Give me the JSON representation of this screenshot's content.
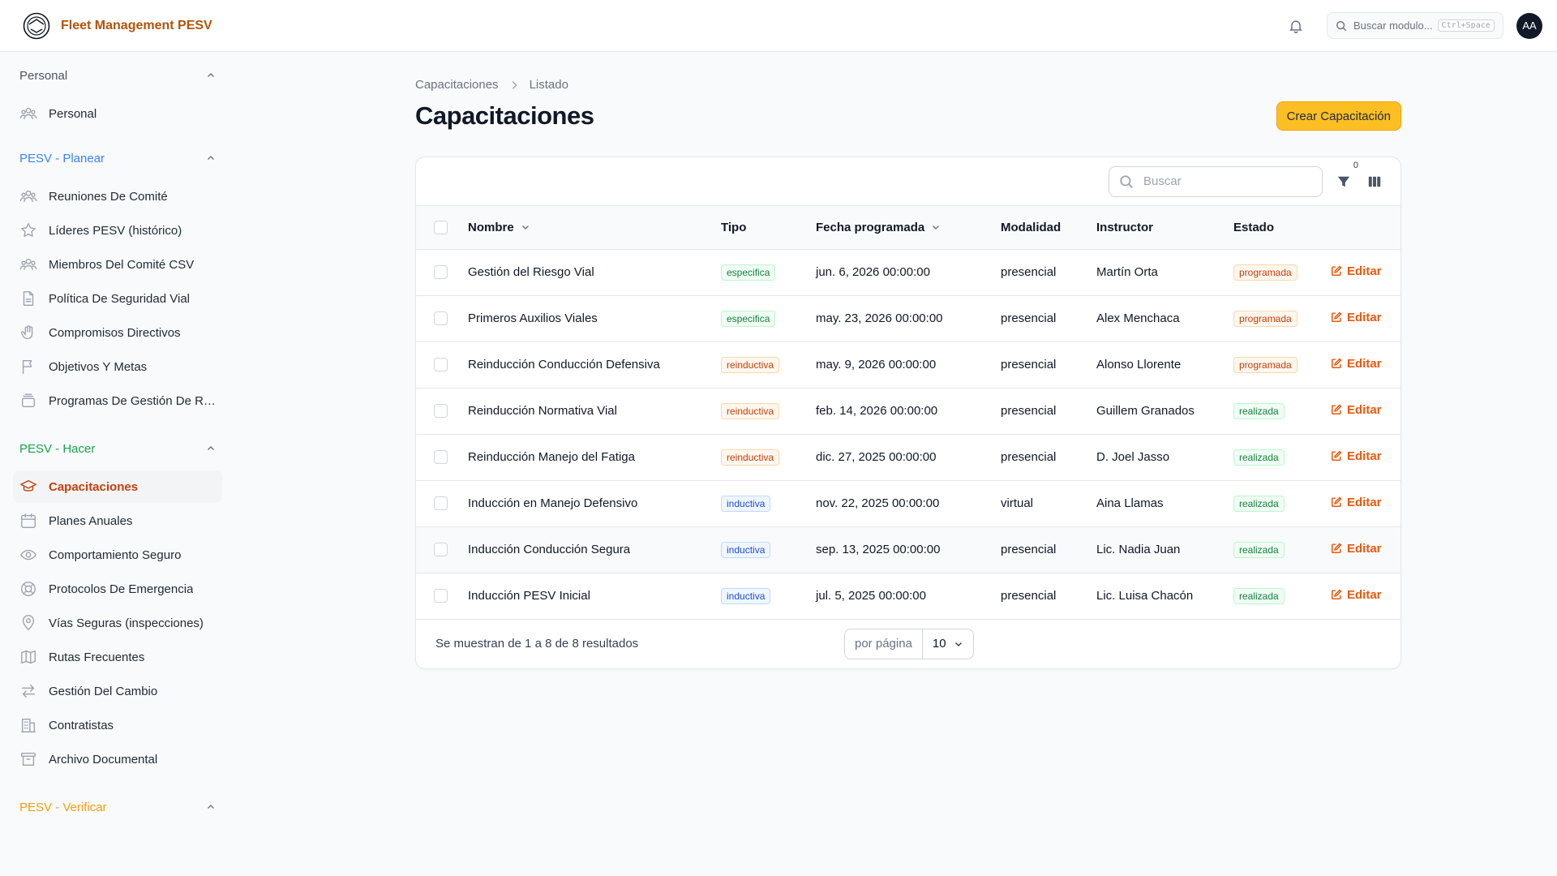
{
  "app": {
    "title": "Fleet Management PESV"
  },
  "topbar": {
    "search_placeholder": "Buscar modulo...",
    "search_shortcut": "Ctrl+Space",
    "avatar_initials": "AA"
  },
  "sidebar": {
    "groups": [
      {
        "label": "Personal",
        "color": "#4b5563",
        "items": [
          {
            "label": "Personal",
            "icon": "users-icon"
          }
        ]
      },
      {
        "label": "PESV - Planear",
        "color": "#3b82f6",
        "items": [
          {
            "label": "Reuniones De Comité",
            "icon": "users-icon"
          },
          {
            "label": "Líderes PESV (histórico)",
            "icon": "star-icon"
          },
          {
            "label": "Miembros Del Comité CSV",
            "icon": "users-icon"
          },
          {
            "label": "Política De Seguridad Vial",
            "icon": "document-icon"
          },
          {
            "label": "Compromisos Directivos",
            "icon": "hand-icon"
          },
          {
            "label": "Objetivos Y Metas",
            "icon": "flag-icon"
          },
          {
            "label": "Programas De Gestión De Ries...",
            "icon": "stack-icon"
          }
        ]
      },
      {
        "label": "PESV - Hacer",
        "color": "#16a34a",
        "items": [
          {
            "label": "Capacitaciones",
            "icon": "academic-cap-icon",
            "active": true
          },
          {
            "label": "Planes Anuales",
            "icon": "calendar-icon"
          },
          {
            "label": "Comportamiento Seguro",
            "icon": "eye-icon"
          },
          {
            "label": "Protocolos De Emergencia",
            "icon": "lifebuoy-icon"
          },
          {
            "label": "Vías Seguras (inspecciones)",
            "icon": "map-pin-icon"
          },
          {
            "label": "Rutas Frecuentes",
            "icon": "map-icon"
          },
          {
            "label": "Gestión Del Cambio",
            "icon": "arrows-icon"
          },
          {
            "label": "Contratistas",
            "icon": "building-icon"
          },
          {
            "label": "Archivo Documental",
            "icon": "archive-icon"
          }
        ]
      },
      {
        "label": "PESV - Verificar",
        "color": "#f59e0b",
        "items": []
      }
    ]
  },
  "breadcrumb": {
    "root": "Capacitaciones",
    "current": "Listado"
  },
  "page": {
    "title": "Capacitaciones",
    "create_button": "Crear Capacitación"
  },
  "table": {
    "search_placeholder": "Buscar",
    "filter_count": "0",
    "columns": {
      "nombre": "Nombre",
      "tipo": "Tipo",
      "fecha": "Fecha programada",
      "modalidad": "Modalidad",
      "instructor": "Instructor",
      "estado": "Estado"
    },
    "edit_label": "Editar",
    "rows": [
      {
        "nombre": "Gestión del Riesgo Vial",
        "tipo": "especifica",
        "tipo_color": "green",
        "fecha": "jun. 6, 2026 00:00:00",
        "modalidad": "presencial",
        "instructor": "Martín Orta",
        "estado": "programada",
        "estado_color": "orange"
      },
      {
        "nombre": "Primeros Auxilios Viales",
        "tipo": "especifica",
        "tipo_color": "green",
        "fecha": "may. 23, 2026 00:00:00",
        "modalidad": "presencial",
        "instructor": "Alex Menchaca",
        "estado": "programada",
        "estado_color": "orange"
      },
      {
        "nombre": "Reinducción Conducción Defensiva",
        "tipo": "reinductiva",
        "tipo_color": "orange",
        "fecha": "may. 9, 2026 00:00:00",
        "modalidad": "presencial",
        "instructor": "Alonso Llorente",
        "estado": "programada",
        "estado_color": "orange"
      },
      {
        "nombre": "Reinducción Normativa Vial",
        "tipo": "reinductiva",
        "tipo_color": "orange",
        "fecha": "feb. 14, 2026 00:00:00",
        "modalidad": "presencial",
        "instructor": "Guillem Granados",
        "estado": "realizada",
        "estado_color": "green"
      },
      {
        "nombre": "Reinducción Manejo del Fatiga",
        "tipo": "reinductiva",
        "tipo_color": "orange",
        "fecha": "dic. 27, 2025 00:00:00",
        "modalidad": "presencial",
        "instructor": "D. Joel Jasso",
        "estado": "realizada",
        "estado_color": "green"
      },
      {
        "nombre": "Inducción en Manejo Defensivo",
        "tipo": "inductiva",
        "tipo_color": "blue",
        "fecha": "nov. 22, 2025 00:00:00",
        "modalidad": "virtual",
        "instructor": "Aina Llamas",
        "estado": "realizada",
        "estado_color": "green"
      },
      {
        "nombre": "Inducción Conducción Segura",
        "tipo": "inductiva",
        "tipo_color": "blue",
        "fecha": "sep. 13, 2025 00:00:00",
        "modalidad": "presencial",
        "instructor": "Lic. Nadia Juan",
        "estado": "realizada",
        "estado_color": "green",
        "highlight": true
      },
      {
        "nombre": "Inducción PESV Inicial",
        "tipo": "inductiva",
        "tipo_color": "blue",
        "fecha": "jul. 5, 2025 00:00:00",
        "modalidad": "presencial",
        "instructor": "Lic. Luisa Chacón",
        "estado": "realizada",
        "estado_color": "green"
      }
    ],
    "footer": {
      "summary": "Se muestran de 1 a 8 de 8 resultados",
      "per_page_label": "por página",
      "per_page_value": "10"
    }
  }
}
